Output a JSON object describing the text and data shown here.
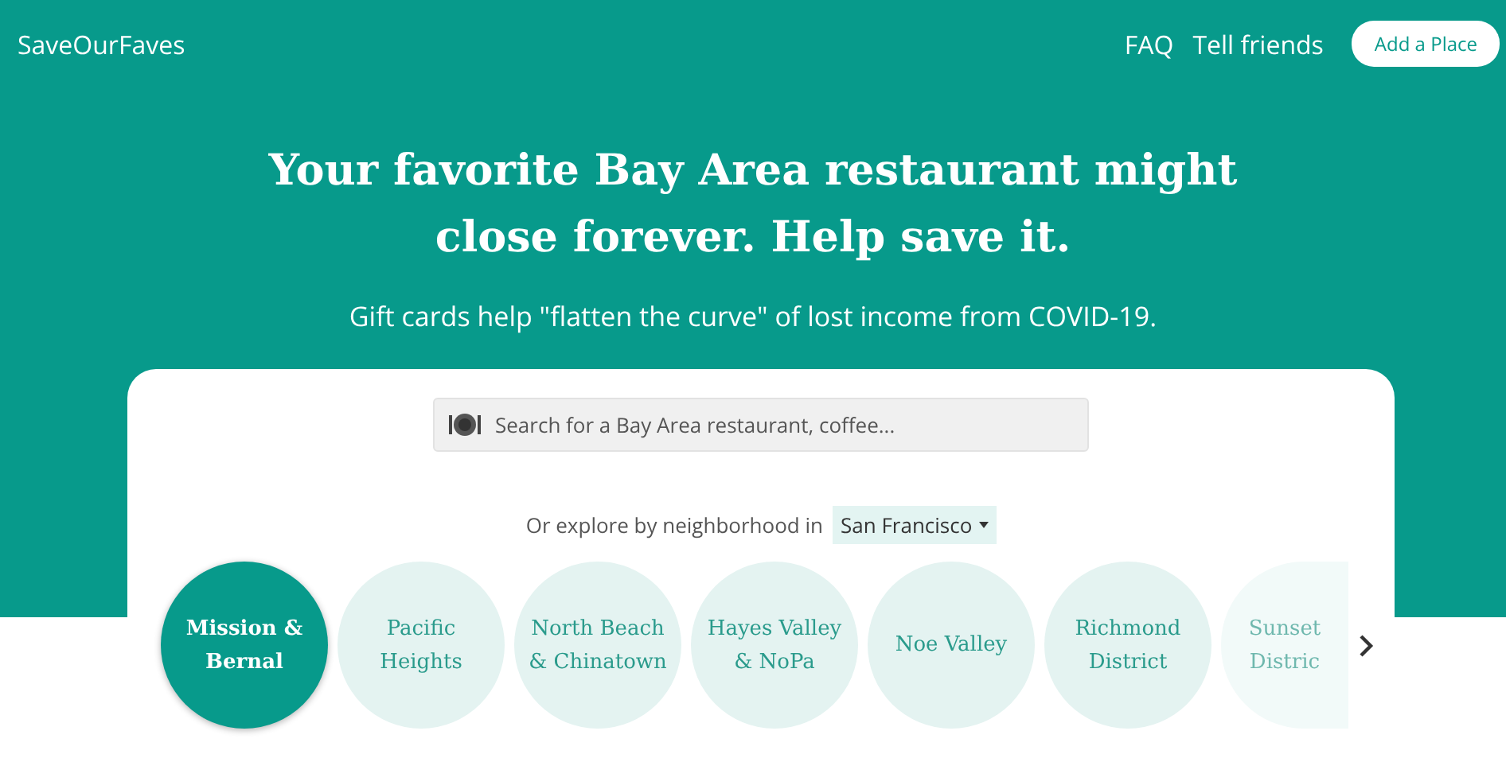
{
  "nav": {
    "brand": "SaveOurFaves",
    "links": [
      "FAQ",
      "Tell friends"
    ],
    "button": "Add a Place"
  },
  "hero": {
    "title": "Your favorite Bay Area restaurant might close forever. Help save it.",
    "subtitle": "Gift cards help \"flatten the curve\" of lost income from COVID-19."
  },
  "search": {
    "placeholder": "Search for a Bay Area restaurant, coffee..."
  },
  "explore": {
    "label": "Or explore by neighborhood in",
    "city": "San Francisco"
  },
  "neighborhoods": [
    {
      "name": "Mission & Bernal",
      "selected": true,
      "faded": false
    },
    {
      "name": "Pacific Heights",
      "selected": false,
      "faded": false
    },
    {
      "name": "North Beach & Chinatown",
      "selected": false,
      "faded": false
    },
    {
      "name": "Hayes Valley & NoPa",
      "selected": false,
      "faded": false
    },
    {
      "name": "Noe Valley",
      "selected": false,
      "faded": false
    },
    {
      "name": "Richmond District",
      "selected": false,
      "faded": false
    },
    {
      "name": "Sunset Distric",
      "selected": false,
      "faded": true
    }
  ]
}
